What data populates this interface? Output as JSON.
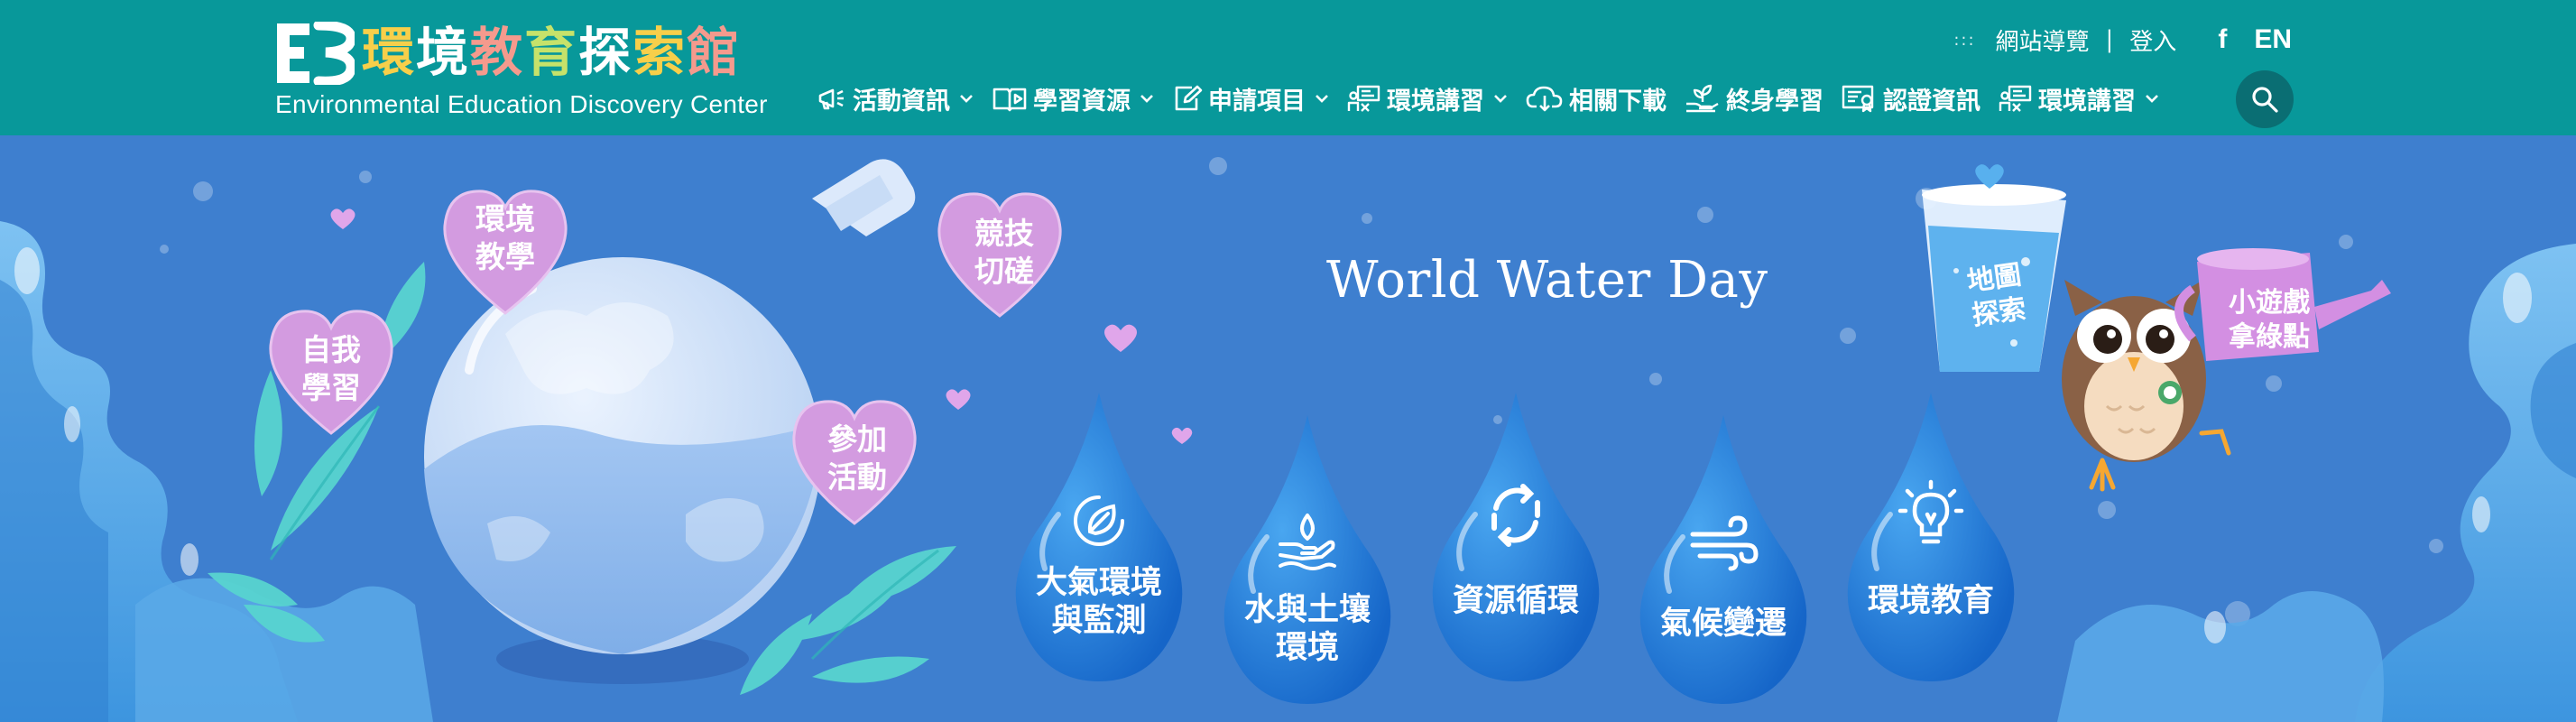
{
  "header": {
    "logo": {
      "title_zh": "環境教育探索館",
      "title_en": "Environmental Education Discovery Center"
    },
    "utility": {
      "sitemap": "網站導覽",
      "separator": "|",
      "login": "登入",
      "facebook": "f",
      "language": "EN"
    },
    "nav": [
      {
        "label": "活動資訊",
        "icon": "megaphone-icon",
        "has_dropdown": true
      },
      {
        "label": "學習資源",
        "icon": "book-play-icon",
        "has_dropdown": true
      },
      {
        "label": "申請項目",
        "icon": "edit-form-icon",
        "has_dropdown": true
      },
      {
        "label": "環境講習",
        "icon": "classroom-icon",
        "has_dropdown": true
      },
      {
        "label": "相關下載",
        "icon": "cloud-download-icon",
        "has_dropdown": false
      },
      {
        "label": "終身學習",
        "icon": "sprout-hand-icon",
        "has_dropdown": false
      },
      {
        "label": "認證資訊",
        "icon": "certificate-icon",
        "has_dropdown": false
      },
      {
        "label": "環境講習",
        "icon": "classroom-icon",
        "has_dropdown": true
      }
    ],
    "search_icon": "search-icon"
  },
  "hero": {
    "title": "World Water Day",
    "hearts": [
      {
        "label": "環境\n教學"
      },
      {
        "label": "自我\n學習"
      },
      {
        "label": "競技\n切磋"
      },
      {
        "label": "參加\n活動"
      }
    ],
    "drops": [
      {
        "label": "大氣環境\n與監測",
        "icon": "leaf-circle-icon"
      },
      {
        "label": "水與土壤\n環境",
        "icon": "hand-water-icon"
      },
      {
        "label": "資源循環",
        "icon": "recycle-arrows-icon"
      },
      {
        "label": "氣候變遷",
        "icon": "wind-icon"
      },
      {
        "label": "環境教育",
        "icon": "lightbulb-icon"
      }
    ],
    "map_explore": "地圖\n探索",
    "mini_game": "小遊戲\n拿綠點"
  },
  "colors": {
    "header": "#08989a",
    "hero": "#3e7fcf",
    "heart": "#d39be0",
    "drop": "#1f72d6",
    "search_bg": "#0a6e73"
  }
}
